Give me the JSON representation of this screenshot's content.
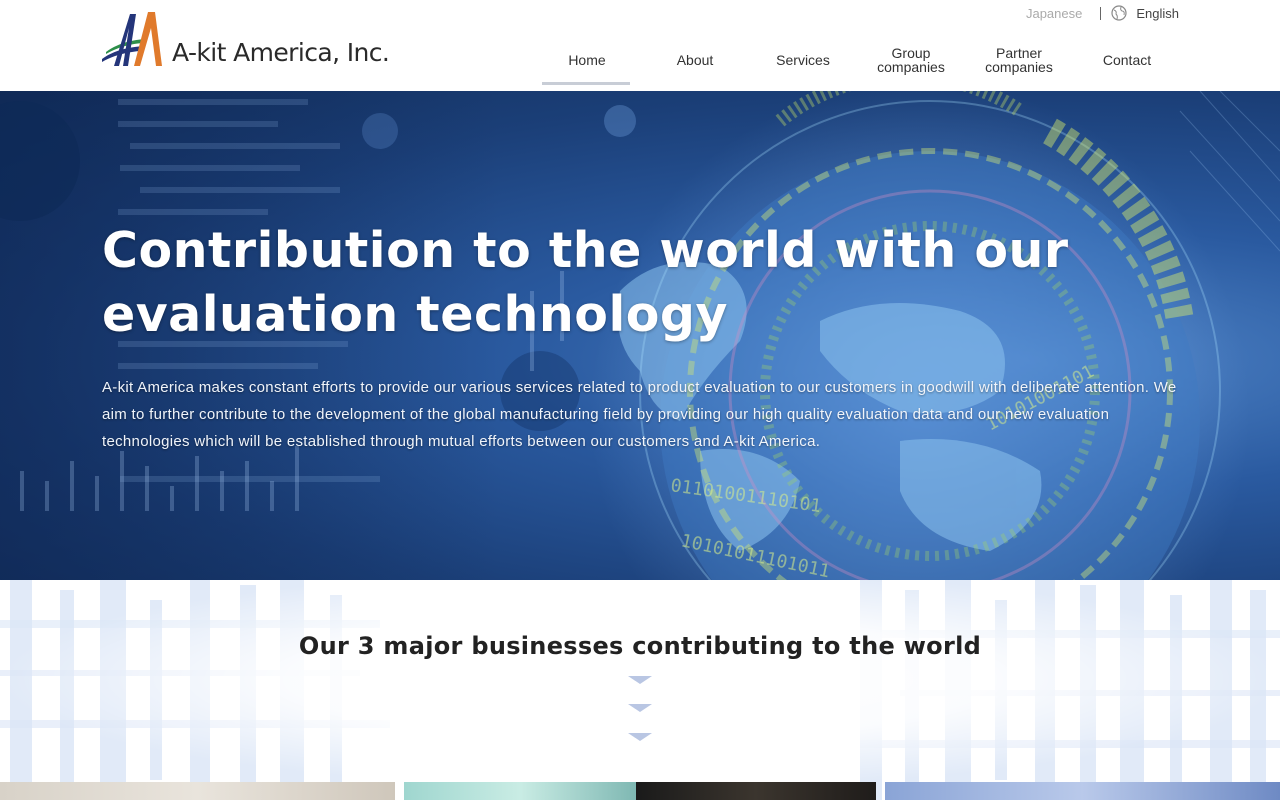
{
  "brand": {
    "name": "A-kit America, Inc.",
    "colors": {
      "navy": "#24357a",
      "orange": "#e07a2c",
      "green": "#2e8f4a"
    }
  },
  "language": {
    "japanese": "Japanese",
    "english": "English",
    "icon": "globe-icon"
  },
  "nav": {
    "items": [
      {
        "label": "Home",
        "active": true
      },
      {
        "label": "About"
      },
      {
        "label": "Services"
      },
      {
        "label": "Group\ncompanies"
      },
      {
        "label": "Partner\ncompanies"
      },
      {
        "label": "Contact"
      }
    ]
  },
  "hero": {
    "title": "Contribution to the world with our evaluation technology",
    "text": "A-kit America makes constant efforts to provide our various services related to product evaluation to our customers in goodwill with deliberate attention. We aim to further contribute to the development of the global manufacturing field by providing our high quality evaluation data and our new evaluation technologies which will be established through mutual efforts between our customers and A-kit America."
  },
  "businesses": {
    "title": "Our 3 major businesses contributing to the world",
    "chevron_icon": "chevron-down-icon",
    "chevron_color": "#b9c6e3"
  }
}
